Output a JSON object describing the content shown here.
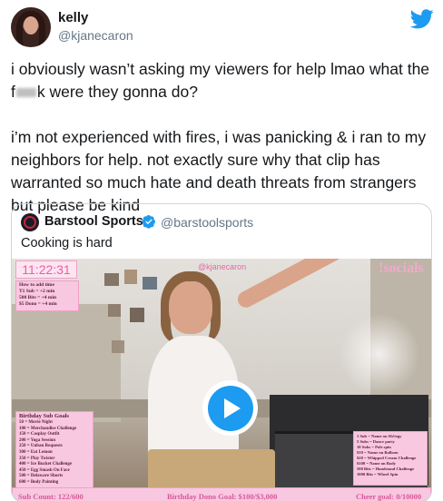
{
  "author": {
    "name": "kelly",
    "handle": "@kjanecaron"
  },
  "tweet": {
    "paragraph1_before": "i obviously wasn’t asking my viewers for help lmao what the f",
    "paragraph1_after": "k were they gonna do?",
    "paragraph2": "i’m not experienced with fires, i was panicking & i ran to my neighbors for help. not exactly sure why that clip has warranted so much hate and death threats from strangers but please be kind"
  },
  "quoted_tweet": {
    "name": "Barstool Sports",
    "handle": "@barstoolsports",
    "text": "Cooking is hard",
    "verified": true
  },
  "video_overlay": {
    "clock": "11:22:31",
    "watermark": "@kjanecaron",
    "socials": "!socials",
    "how_to_add_time": "How to add time\nT1 Sub = +2 min\n500 Bits = +4 min\n$5 Dono = +4 min",
    "goals_title": "Birthday Sub Goals",
    "goals": [
      "50 = Movie Night",
      "100 = Merchandise Challenge",
      "150 = Cosplay Outfit",
      "200 = Yoga Session",
      "250 = Unban Requests",
      "300 = Eat Lemon",
      "350 = Play Twister",
      "400 = Ice Bucket Challenge",
      "450 = Egg Smash On Face",
      "500 = Delaware Shorts",
      "600 = Body Painting"
    ],
    "right_goals": [
      "1 Sub = Name on Sh!tegy",
      "5 Subs = Dance party",
      "10 Subs = Pole spin",
      "$10 = Name on Balloon",
      "$20 = Whipped Cream Challenge",
      "$100 = Name on Body",
      "500 Bits = Handstand Challenge",
      "1000 Bits = Wheel Spin"
    ],
    "sub_count": "Sub Count: 122/600",
    "dono_goal": "Birthday Dono Goal: $100/$3,000",
    "cheer_goal": "Cheer goal: 0/10000"
  },
  "colors": {
    "twitter_blue": "#1d9bf0",
    "overlay_pink": "#f8c8e0",
    "overlay_text": "#d8589a"
  },
  "icons": {
    "brand": "twitter-bird-icon",
    "verified": "verified-badge-icon",
    "play": "play-icon"
  }
}
